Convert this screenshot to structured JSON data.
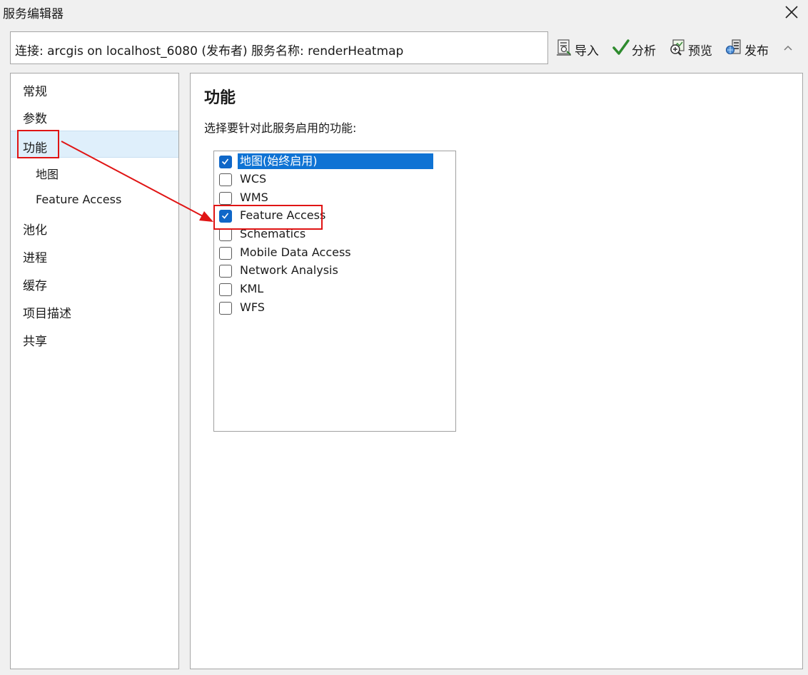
{
  "window": {
    "title": "服务编辑器"
  },
  "connection": {
    "text": "连接: arcgis on localhost_6080 (发布者)   服务名称: renderHeatmap"
  },
  "toolbar": {
    "import_label": "导入",
    "analyze_label": "分析",
    "preview_label": "预览",
    "publish_label": "发布"
  },
  "nav": {
    "items": [
      {
        "label": "常规"
      },
      {
        "label": "参数"
      },
      {
        "label": "功能"
      },
      {
        "label": "地图"
      },
      {
        "label": "Feature Access"
      },
      {
        "label": "池化"
      },
      {
        "label": "进程"
      },
      {
        "label": "缓存"
      },
      {
        "label": "项目描述"
      },
      {
        "label": "共享"
      }
    ],
    "selected": "功能"
  },
  "content": {
    "title": "功能",
    "description": "选择要针对此服务启用的功能:",
    "capabilities": [
      {
        "label": "地图(始终启用)",
        "checked": true
      },
      {
        "label": "WCS",
        "checked": false
      },
      {
        "label": "WMS",
        "checked": false
      },
      {
        "label": "Feature Access",
        "checked": true
      },
      {
        "label": "Schematics",
        "checked": false
      },
      {
        "label": "Mobile Data Access",
        "checked": false
      },
      {
        "label": "Network Analysis",
        "checked": false
      },
      {
        "label": "KML",
        "checked": false
      },
      {
        "label": "WFS",
        "checked": false
      }
    ]
  },
  "colors": {
    "accent": "#0f67c8",
    "annotation": "#e01414",
    "selection": "#dfeffb"
  }
}
